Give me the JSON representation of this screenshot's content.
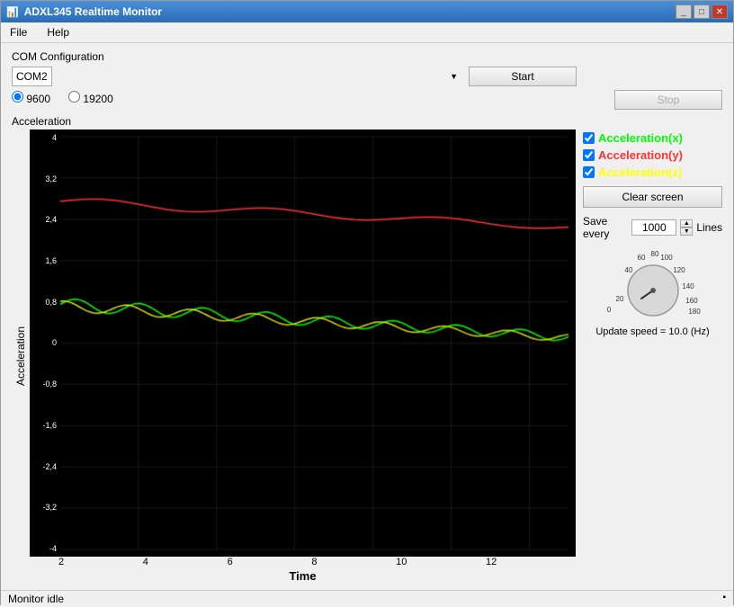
{
  "window": {
    "title": "ADXL345 Realtime Monitor",
    "controls": {
      "minimize": "_",
      "maximize": "□",
      "close": "✕"
    }
  },
  "menu": {
    "items": [
      "File",
      "Help"
    ]
  },
  "com": {
    "label": "COM Configuration",
    "port": "COM2",
    "baud_options": [
      "9600",
      "19200"
    ],
    "selected_baud": "9600"
  },
  "buttons": {
    "start": "Start",
    "stop": "Stop",
    "clear_screen": "Clear screen"
  },
  "chart": {
    "title": "Acceleration",
    "y_label": "Acceleration",
    "x_label": "Time",
    "y_ticks": [
      "4",
      "3,2",
      "2,4",
      "1,6",
      "0,8",
      "0",
      "-0,8",
      "-1,6",
      "-2,4",
      "-3,2",
      "-4"
    ],
    "x_ticks": [
      "2",
      "4",
      "6",
      "8",
      "10",
      "12"
    ]
  },
  "legend": {
    "items": [
      {
        "label": "Acceleration(x)",
        "color": "#00ff00",
        "checked": true
      },
      {
        "label": "Acceleration(y)",
        "color": "#ff0000",
        "checked": true
      },
      {
        "label": "Acceleration(z)",
        "color": "#ffff00",
        "checked": true
      }
    ]
  },
  "save": {
    "label": "Save every",
    "value": "1000",
    "unit": "Lines"
  },
  "knob": {
    "ticks": [
      "0",
      "20",
      "40",
      "60",
      "80",
      "100",
      "120",
      "140",
      "160",
      "180"
    ],
    "value": 30
  },
  "update_speed": {
    "label": "Update speed = 10.0 (Hz)"
  },
  "status": {
    "text": "Monitor idle"
  }
}
